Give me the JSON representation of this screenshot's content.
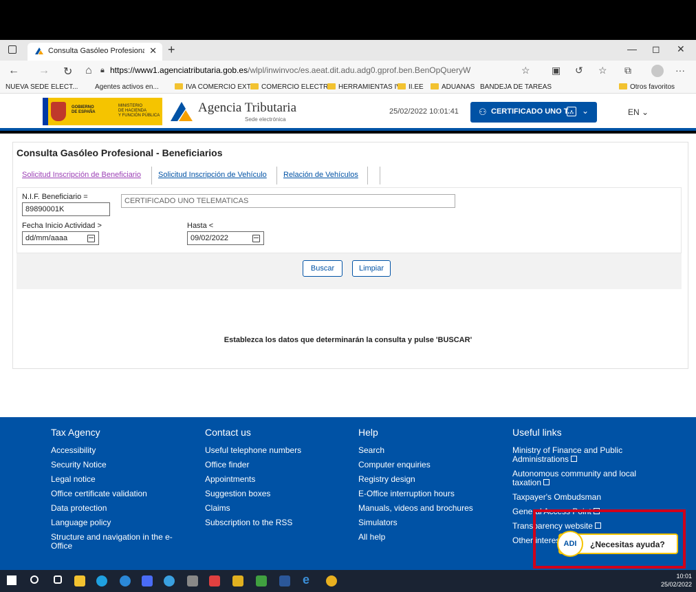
{
  "browser": {
    "tab_title": "Consulta Gasóleo Profesional - B",
    "url_host": "https://www1.agenciatributaria.gob.es",
    "url_path": "/wlpl/inwinvoc/es.aeat.dit.adu.adg0.gprof.ben.BenOpQueryW",
    "bookmarks": [
      "NUEVA SEDE ELECT...",
      "Agentes activos en...",
      "IVA COMERCIO EXT...",
      "COMERCIO ELECTR...",
      "HERRAMIENTAS IVA",
      "II.EE",
      "ADUANAS",
      "BANDEJA DE TAREAS"
    ],
    "other_favorites": "Otros favoritos"
  },
  "header": {
    "gov_line1": "GOBIERNO\nDE ESPAÑA",
    "gov_line2": "MINISTERIO\nDE HACIENDA\nY FUNCIÓN PÚBLICA",
    "agency_name": "Agencia Tributaria",
    "agency_sub": "Sede electrónica",
    "datetime": "25/02/2022 10:01:41",
    "cert_label": "CERTIFICADO UNO T...",
    "language": "EN"
  },
  "main": {
    "title": "Consulta Gasóleo Profesional - Beneficiarios",
    "tabs": [
      "Solicitud Inscripción de Beneficiario",
      "Solicitud Inscripción de Vehículo",
      "Relación de Vehículos"
    ],
    "nif_label": "N.I.F. Beneficiario =",
    "nif_value": "89890001K",
    "name_value": "CERTIFICADO UNO TELEMATICAS",
    "fecha_label": "Fecha Inicio Actividad >",
    "fecha_value": "dd/mm/aaaa",
    "hasta_label": "Hasta <",
    "hasta_value": "09/02/2022",
    "search_button": "Buscar",
    "clear_button": "Limpiar",
    "message": "Establezca los datos que determinarán la consulta y pulse 'BUSCAR'"
  },
  "footer": {
    "columns": [
      {
        "heading": "Tax Agency",
        "items": [
          "Accessibility",
          "Security Notice",
          "Legal notice",
          "Office certificate validation",
          "Data protection",
          "Language policy",
          "Structure and navigation in the e-Office"
        ]
      },
      {
        "heading": "Contact us",
        "items": [
          "Useful telephone numbers",
          "Office finder",
          "Appointments",
          "Suggestion boxes",
          "Claims",
          "Subscription to the RSS"
        ]
      },
      {
        "heading": "Help",
        "items": [
          "Search",
          "Computer enquiries",
          "Registry design",
          "E-Office interruption hours",
          "Manuals, videos and brochures",
          "Simulators",
          "All help"
        ]
      },
      {
        "heading": "Useful links",
        "items": [
          "Ministry of Finance and Public Administrations",
          "Autonomous community and local taxation",
          "Taxpayer's Ombudsman",
          "General Access Point",
          "Transparency website",
          "Other interest"
        ]
      }
    ]
  },
  "help": {
    "avatar_text": "ADI",
    "bubble_text": "¿Necesitas ayuda?"
  },
  "taskbar": {
    "time": "10:01",
    "date": "25/02/2022"
  },
  "colors": {
    "brand_blue": "#0052a5",
    "highlight_red": "#d0021b",
    "gov_yellow": "#f5c400"
  }
}
